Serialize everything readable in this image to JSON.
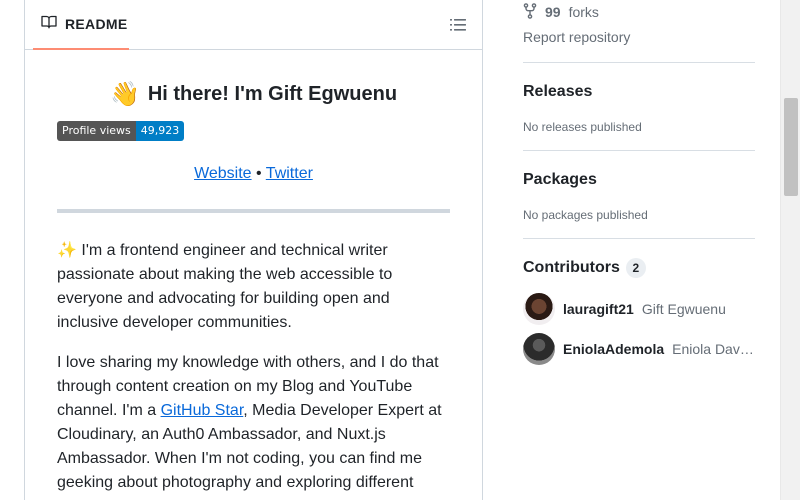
{
  "readme": {
    "tab_label": "README",
    "heading_emoji": "👋",
    "heading": "Hi there! I'm Gift Egwuenu",
    "badge": {
      "label": "Profile views",
      "value": "49,923"
    },
    "links": {
      "website": "Website",
      "separator": "•",
      "twitter": "Twitter"
    },
    "para1": {
      "emoji": "✨",
      "text": " I'm a frontend engineer and technical writer passionate about making the web accessible to everyone and advocating for building open and inclusive developer communities."
    },
    "para2": {
      "before": "I love sharing my knowledge with others, and I do that through content creation on my Blog and YouTube channel. I'm a ",
      "link": "GitHub Star",
      "after": ", Media Developer Expert at Cloudinary, an Auth0 Ambassador, and Nuxt.js Ambassador. When I'm not coding, you can find me geeking about photography and exploring different"
    }
  },
  "sidebar": {
    "forks": {
      "count": "99",
      "label": "forks"
    },
    "report": "Report repository",
    "releases": {
      "title": "Releases",
      "empty": "No releases published"
    },
    "packages": {
      "title": "Packages",
      "empty": "No packages published"
    },
    "contributors": {
      "title": "Contributors",
      "count": "2",
      "items": [
        {
          "login": "lauragift21",
          "name": "Gift Egwuenu"
        },
        {
          "login": "EniolaAdemola",
          "name": "Eniola David ..."
        }
      ]
    }
  },
  "colors": {
    "link": "#0969da",
    "tab_underline": "#fd8c73",
    "badge_value": "#007ec6"
  }
}
